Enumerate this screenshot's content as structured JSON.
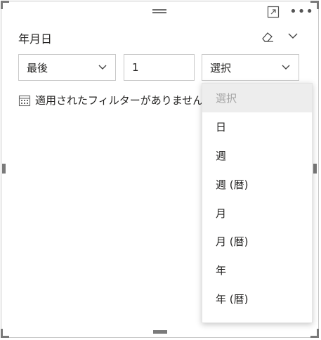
{
  "header": {
    "title": "年月日"
  },
  "filter": {
    "mode_select": "最後",
    "count_input": "1",
    "period_select": "選択",
    "status_text": "適用されたフィルターがありません"
  },
  "dropdown": {
    "placeholder": "選択",
    "options": [
      "日",
      "週",
      "週 (暦)",
      "月",
      "月 (暦)",
      "年",
      "年 (暦)"
    ]
  },
  "icons": [
    "focus-mode-icon",
    "more-options-icon",
    "eraser-icon",
    "chevron-down-icon",
    "calendar-icon"
  ]
}
